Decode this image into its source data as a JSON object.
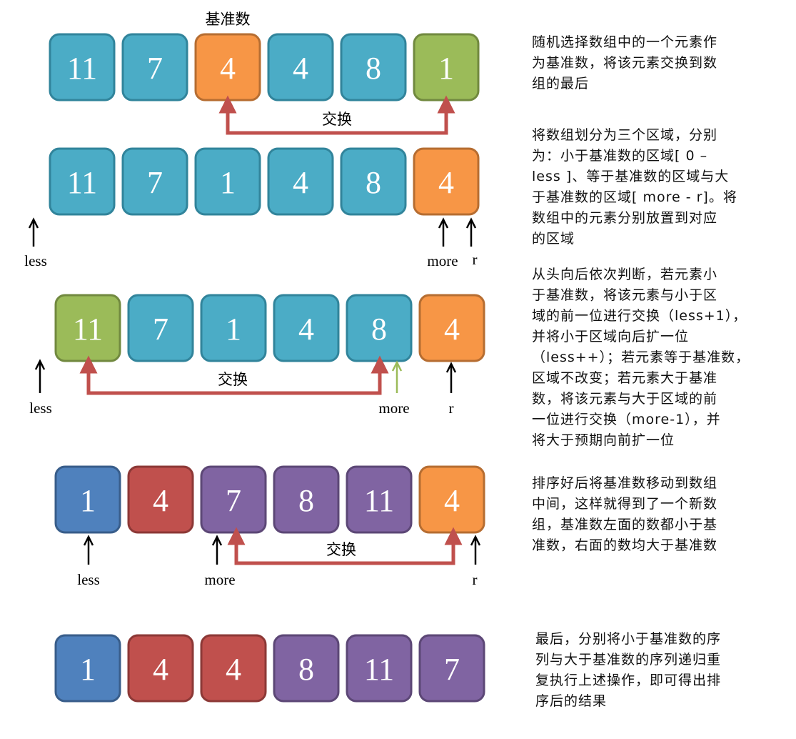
{
  "colors": {
    "teal": "#4BACC6",
    "teal_border": "#31849B",
    "orange": "#F79646",
    "orange_border": "#B66D31",
    "green": "#9BBB59",
    "green_border": "#71893F",
    "blue": "#4F81BD",
    "blue_border": "#385D8A",
    "red": "#C0504D",
    "red_border": "#8C3836",
    "purple": "#8064A2",
    "purple_border": "#5C4776",
    "swap_arrow": "#C0504D",
    "pointer_black": "#000000",
    "pointer_green": "#9BBB59"
  },
  "steps": [
    {
      "id": "step1",
      "cells": [
        {
          "value": "11",
          "color": "teal"
        },
        {
          "value": "7",
          "color": "teal"
        },
        {
          "value": "4",
          "color": "orange"
        },
        {
          "value": "4",
          "color": "teal"
        },
        {
          "value": "8",
          "color": "teal"
        },
        {
          "value": "1",
          "color": "green"
        }
      ],
      "caption": "基准数",
      "swap_label": "交换",
      "pointers": [],
      "description": [
        "随机选择数组中的一个元素作",
        "为基准数，将该元素交换到数",
        "组的最后"
      ]
    },
    {
      "id": "step2",
      "cells": [
        {
          "value": "11",
          "color": "teal"
        },
        {
          "value": "7",
          "color": "teal"
        },
        {
          "value": "1",
          "color": "teal"
        },
        {
          "value": "4",
          "color": "teal"
        },
        {
          "value": "8",
          "color": "teal"
        },
        {
          "value": "4",
          "color": "orange"
        }
      ],
      "pointers": [
        {
          "label": "less",
          "color": "pointer_black"
        },
        {
          "label": "more",
          "color": "pointer_black"
        },
        {
          "label": "r",
          "color": "pointer_black"
        }
      ],
      "description": [
        "将数组划分为三个区域，分别",
        "为：小于基准数的区域[ 0 –",
        "less ]、等于基准数的区域与大",
        "于基准数的区域[ more - r]。将",
        "数组中的元素分别放置到对应",
        "的区域"
      ]
    },
    {
      "id": "step3",
      "cells": [
        {
          "value": "11",
          "color": "green"
        },
        {
          "value": "7",
          "color": "teal"
        },
        {
          "value": "1",
          "color": "teal"
        },
        {
          "value": "4",
          "color": "teal"
        },
        {
          "value": "8",
          "color": "teal"
        },
        {
          "value": "4",
          "color": "orange"
        }
      ],
      "swap_label": "交换",
      "pointers": [
        {
          "label": "less",
          "color": "pointer_black"
        },
        {
          "label": "more",
          "color": "pointer_green"
        },
        {
          "label": "r",
          "color": "pointer_black"
        }
      ],
      "description": [
        "从头向后依次判断，若元素小",
        "于基准数，将该元素与小于区",
        "域的前一位进行交换（less+1），",
        "并将小于区域向后扩一位",
        "（less++）；若元素等于基准数，",
        "区域不改变；若元素大于基准",
        "数，将该元素与大于区域的前",
        "一位进行交换（more-1），并",
        "将大于预期向前扩一位"
      ]
    },
    {
      "id": "step4",
      "cells": [
        {
          "value": "1",
          "color": "blue"
        },
        {
          "value": "4",
          "color": "red"
        },
        {
          "value": "7",
          "color": "purple"
        },
        {
          "value": "8",
          "color": "purple"
        },
        {
          "value": "11",
          "color": "purple"
        },
        {
          "value": "4",
          "color": "orange"
        }
      ],
      "swap_label": "交换",
      "pointers": [
        {
          "label": "less",
          "color": "pointer_black"
        },
        {
          "label": "more",
          "color": "pointer_black"
        },
        {
          "label": "r",
          "color": "pointer_black"
        }
      ],
      "description": [
        "排序好后将基准数移动到数组",
        "中间，这样就得到了一个新数",
        "组，基准数左面的数都小于基",
        "准数，右面的数均大于基准数"
      ]
    },
    {
      "id": "step5",
      "cells": [
        {
          "value": "1",
          "color": "blue"
        },
        {
          "value": "4",
          "color": "red"
        },
        {
          "value": "4",
          "color": "red"
        },
        {
          "value": "8",
          "color": "purple"
        },
        {
          "value": "11",
          "color": "purple"
        },
        {
          "value": "7",
          "color": "purple"
        }
      ],
      "pointers": [],
      "description": [
        "最后，分别将小于基准数的序",
        "列与大于基准数的序列递归重",
        "复执行上述操作，即可得出排",
        "序后的结果"
      ]
    }
  ]
}
